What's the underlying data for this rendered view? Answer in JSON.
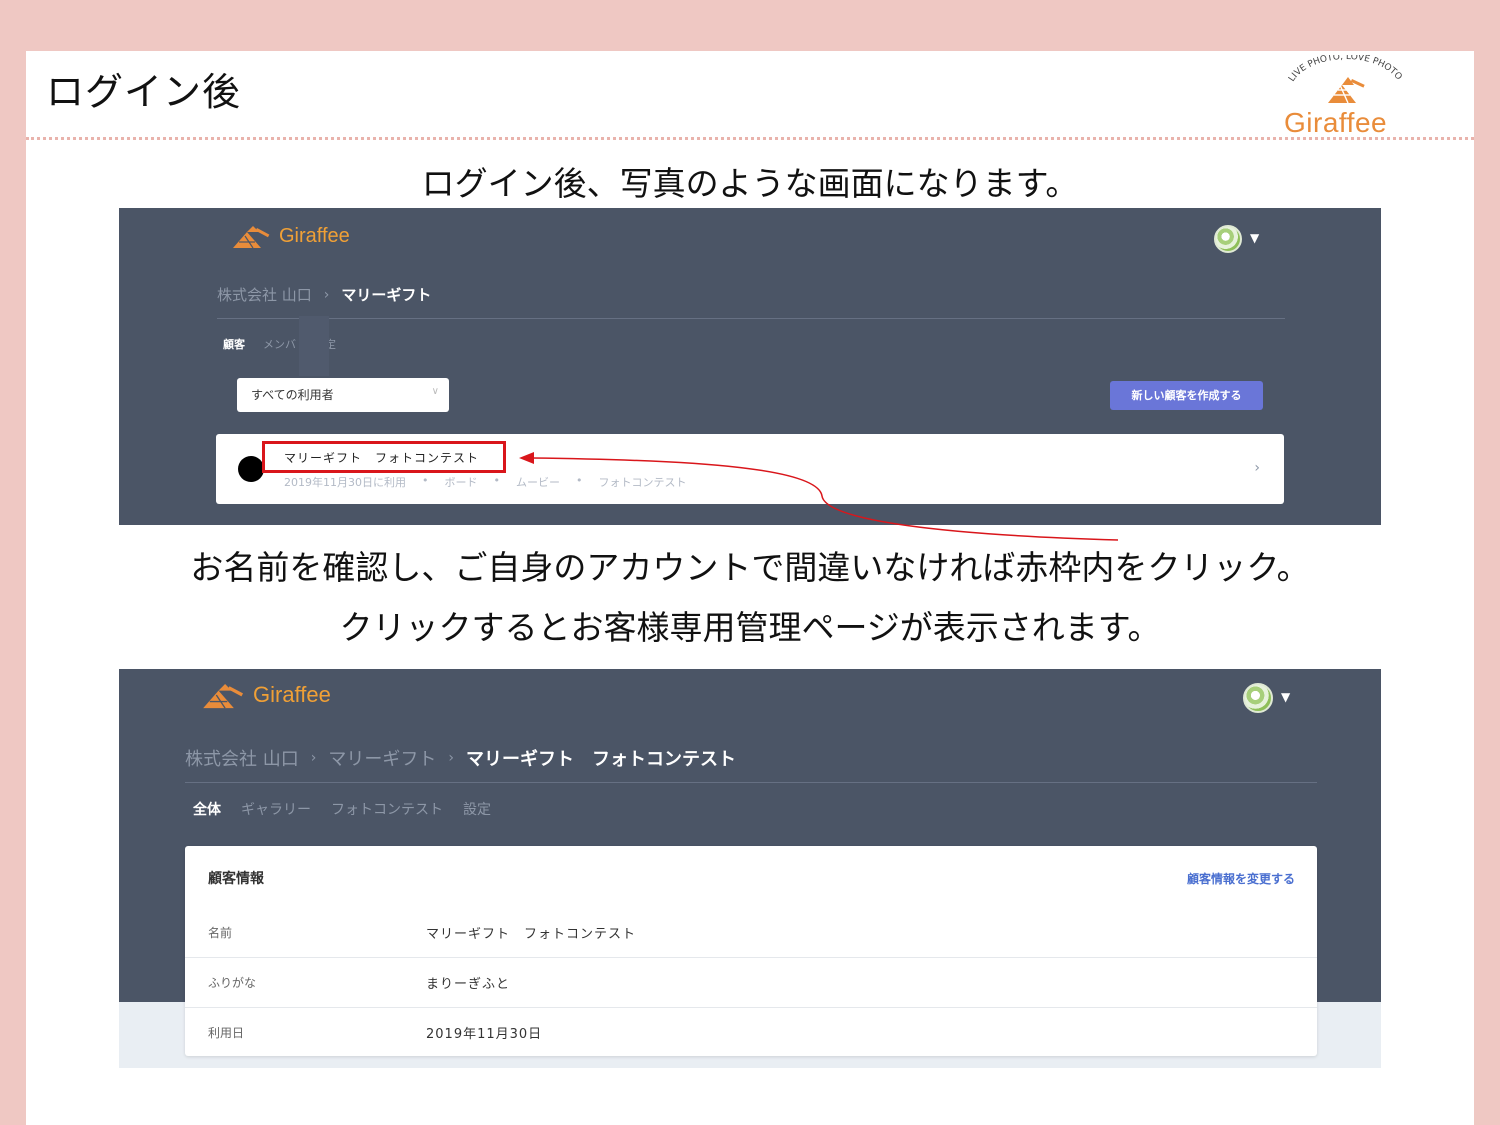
{
  "slide": {
    "title": "ログイン後",
    "brand": {
      "name": "Giraffee",
      "tagline": "LIVE PHOTO, LOVE PHOTO",
      "color": "#e98c3a"
    },
    "caption_top": "ログイン後、写真のような画面になります。",
    "caption_mid1": "お名前を確認し、ご自身のアカウントで間違いなければ赤枠内をクリック。",
    "caption_mid2": "クリックするとお客様専用管理ページが表示されます。"
  },
  "screen1": {
    "logo": "Giraffee",
    "breadcrumb": [
      "株式会社 山口",
      "マリーギフト"
    ],
    "tabs": [
      "顧客",
      "メンバ",
      "設定"
    ],
    "filter_select": "すべての利用者",
    "new_button": "新しい顧客を作成する",
    "customer": {
      "name": "マリーギフト　フォトコンテスト",
      "date": "2019年11月30日に利用",
      "tags": [
        "ボード",
        "ムービー",
        "フォトコンテスト"
      ]
    },
    "highlight_color": "#d9161b"
  },
  "screen2": {
    "logo": "Giraffee",
    "breadcrumb": [
      "株式会社 山口",
      "マリーギフト",
      "マリーギフト　フォトコンテスト"
    ],
    "tabs": [
      "全体",
      "ギャラリー",
      "フォトコンテスト",
      "設定"
    ],
    "card": {
      "title": "顧客情報",
      "edit_link": "顧客情報を変更する",
      "rows": [
        {
          "label": "名前",
          "value": "マリーギフト　フォトコンテスト"
        },
        {
          "label": "ふりがな",
          "value": "まりーぎふと"
        },
        {
          "label": "利用日",
          "value": "2019年11月30日"
        }
      ]
    }
  }
}
